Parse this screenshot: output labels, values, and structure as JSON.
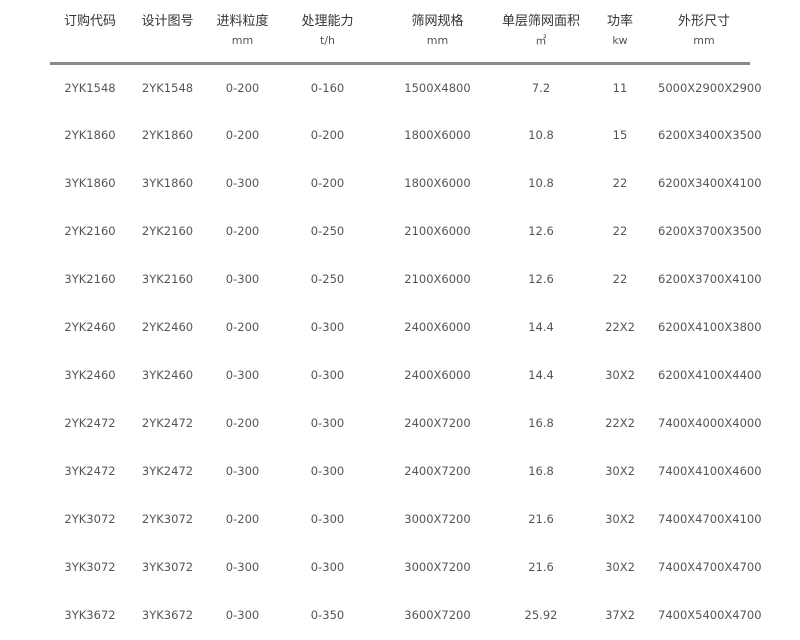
{
  "columns": [
    {
      "label": "订购代码",
      "unit": ""
    },
    {
      "label": "设计图号",
      "unit": ""
    },
    {
      "label": "进料粒度",
      "unit": "mm"
    },
    {
      "label": "处理能力",
      "unit": "t/h"
    },
    {
      "label": "筛网规格",
      "unit": "mm"
    },
    {
      "label": "单层筛网面积",
      "unit": "㎡"
    },
    {
      "label": "功率",
      "unit": "kw"
    },
    {
      "label": "外形尺寸",
      "unit": "mm"
    }
  ],
  "rows": [
    [
      "2YK1548",
      "2YK1548",
      "0-200",
      "0-160",
      "1500X4800",
      "7.2",
      "11",
      "5000X2900X2900"
    ],
    [
      "2YK1860",
      "2YK1860",
      "0-200",
      "0-200",
      "1800X6000",
      "10.8",
      "15",
      "6200X3400X3500"
    ],
    [
      "3YK1860",
      "3YK1860",
      "0-300",
      "0-200",
      "1800X6000",
      "10.8",
      "22",
      "6200X3400X4100"
    ],
    [
      "2YK2160",
      "2YK2160",
      "0-200",
      "0-250",
      "2100X6000",
      "12.6",
      "22",
      "6200X3700X3500"
    ],
    [
      "3YK2160",
      "3YK2160",
      "0-300",
      "0-250",
      "2100X6000",
      "12.6",
      "22",
      "6200X3700X4100"
    ],
    [
      "2YK2460",
      "2YK2460",
      "0-200",
      "0-300",
      "2400X6000",
      "14.4",
      "22X2",
      "6200X4100X3800"
    ],
    [
      "3YK2460",
      "3YK2460",
      "0-300",
      "0-300",
      "2400X6000",
      "14.4",
      "30X2",
      "6200X4100X4400"
    ],
    [
      "2YK2472",
      "2YK2472",
      "0-200",
      "0-300",
      "2400X7200",
      "16.8",
      "22X2",
      "7400X4000X4000"
    ],
    [
      "3YK2472",
      "3YK2472",
      "0-300",
      "0-300",
      "2400X7200",
      "16.8",
      "30X2",
      "7400X4100X4600"
    ],
    [
      "2YK3072",
      "2YK3072",
      "0-200",
      "0-300",
      "3000X7200",
      "21.6",
      "30X2",
      "7400X4700X4100"
    ],
    [
      "3YK3072",
      "3YK3072",
      "0-300",
      "0-300",
      "3000X7200",
      "21.6",
      "30X2",
      "7400X4700X4700"
    ],
    [
      "3YK3672",
      "3YK3672",
      "0-300",
      "0-350",
      "3600X7200",
      "25.92",
      "37X2",
      "7400X5400X4700"
    ]
  ]
}
